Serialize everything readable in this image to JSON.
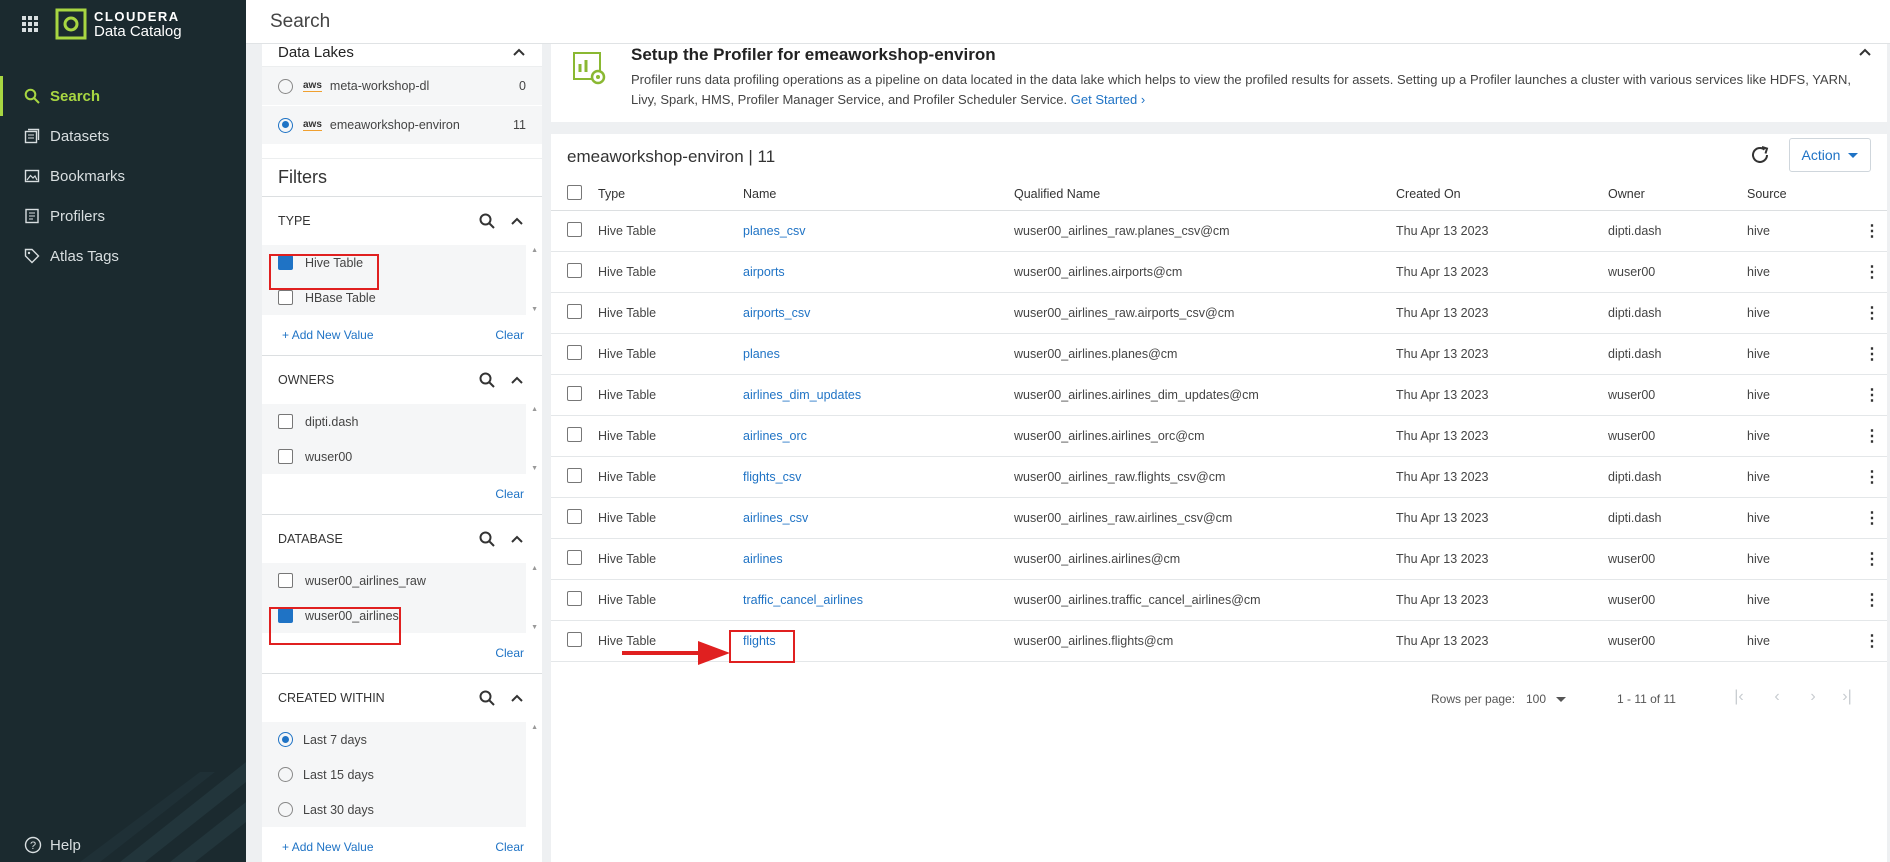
{
  "app": {
    "brand_name": "CLOUDERA",
    "product_name": "Data Catalog",
    "page_title": "Search"
  },
  "nav": {
    "items": [
      {
        "label": "Search",
        "icon": "search-icon",
        "active": true
      },
      {
        "label": "Datasets",
        "icon": "datasets-icon",
        "active": false
      },
      {
        "label": "Bookmarks",
        "icon": "bookmarks-icon",
        "active": false
      },
      {
        "label": "Profilers",
        "icon": "profilers-icon",
        "active": false
      },
      {
        "label": "Atlas Tags",
        "icon": "tag-icon",
        "active": false
      }
    ],
    "help_label": "Help"
  },
  "data_lakes": {
    "title": "Data Lakes",
    "items": [
      {
        "provider": "aws",
        "name": "meta-workshop-dl",
        "count": "0",
        "selected": false
      },
      {
        "provider": "aws",
        "name": "emeaworkshop-environ",
        "count": "11",
        "selected": true
      }
    ]
  },
  "filters": {
    "title": "Filters",
    "type": {
      "label": "TYPE",
      "options": [
        {
          "label": "Hive Table",
          "checked": true
        },
        {
          "label": "HBase Table",
          "checked": false
        }
      ],
      "add_label": "Add New Value",
      "clear_label": "Clear"
    },
    "owners": {
      "label": "OWNERS",
      "options": [
        {
          "label": "dipti.dash",
          "checked": false
        },
        {
          "label": "wuser00",
          "checked": false
        }
      ],
      "clear_label": "Clear"
    },
    "database": {
      "label": "DATABASE",
      "options": [
        {
          "label": "wuser00_airlines_raw",
          "checked": false
        },
        {
          "label": "wuser00_airlines",
          "checked": true
        }
      ],
      "clear_label": "Clear"
    },
    "created_within": {
      "label": "CREATED WITHIN",
      "options": [
        {
          "label": "Last 7 days",
          "selected": true
        },
        {
          "label": "Last 15 days",
          "selected": false
        },
        {
          "label": "Last 30 days",
          "selected": false
        }
      ],
      "add_label": "Add New Value",
      "clear_label": "Clear"
    }
  },
  "banner": {
    "title": "Setup the Profiler for emeaworkshop-environ",
    "description": "Profiler runs data profiling operations as a pipeline on data located in the data lake which helps to view the profiled results for assets. Setting up a Profiler launches a cluster with various services like HDFS, YARN, Livy, Spark, HMS, Profiler Manager Service, and Profiler Scheduler Service.",
    "link_label": "Get Started"
  },
  "results": {
    "title": "emeaworkshop-environ | 11",
    "action_label": "Action",
    "columns": [
      "Type",
      "Name",
      "Qualified Name",
      "Created On",
      "Owner",
      "Source"
    ],
    "rows": [
      {
        "type": "Hive Table",
        "name": "planes_csv",
        "qualified_name": "wuser00_airlines_raw.planes_csv@cm",
        "created_on": "Thu Apr 13 2023",
        "owner": "dipti.dash",
        "source": "hive"
      },
      {
        "type": "Hive Table",
        "name": "airports",
        "qualified_name": "wuser00_airlines.airports@cm",
        "created_on": "Thu Apr 13 2023",
        "owner": "wuser00",
        "source": "hive"
      },
      {
        "type": "Hive Table",
        "name": "airports_csv",
        "qualified_name": "wuser00_airlines_raw.airports_csv@cm",
        "created_on": "Thu Apr 13 2023",
        "owner": "dipti.dash",
        "source": "hive"
      },
      {
        "type": "Hive Table",
        "name": "planes",
        "qualified_name": "wuser00_airlines.planes@cm",
        "created_on": "Thu Apr 13 2023",
        "owner": "dipti.dash",
        "source": "hive"
      },
      {
        "type": "Hive Table",
        "name": "airlines_dim_updates",
        "qualified_name": "wuser00_airlines.airlines_dim_updates@cm",
        "created_on": "Thu Apr 13 2023",
        "owner": "wuser00",
        "source": "hive"
      },
      {
        "type": "Hive Table",
        "name": "airlines_orc",
        "qualified_name": "wuser00_airlines.airlines_orc@cm",
        "created_on": "Thu Apr 13 2023",
        "owner": "wuser00",
        "source": "hive"
      },
      {
        "type": "Hive Table",
        "name": "flights_csv",
        "qualified_name": "wuser00_airlines_raw.flights_csv@cm",
        "created_on": "Thu Apr 13 2023",
        "owner": "dipti.dash",
        "source": "hive"
      },
      {
        "type": "Hive Table",
        "name": "airlines_csv",
        "qualified_name": "wuser00_airlines_raw.airlines_csv@cm",
        "created_on": "Thu Apr 13 2023",
        "owner": "dipti.dash",
        "source": "hive"
      },
      {
        "type": "Hive Table",
        "name": "airlines",
        "qualified_name": "wuser00_airlines.airlines@cm",
        "created_on": "Thu Apr 13 2023",
        "owner": "wuser00",
        "source": "hive"
      },
      {
        "type": "Hive Table",
        "name": "traffic_cancel_airlines",
        "qualified_name": "wuser00_airlines.traffic_cancel_airlines@cm",
        "created_on": "Thu Apr 13 2023",
        "owner": "wuser00",
        "source": "hive"
      },
      {
        "type": "Hive Table",
        "name": "flights",
        "qualified_name": "wuser00_airlines.flights@cm",
        "created_on": "Thu Apr 13 2023",
        "owner": "wuser00",
        "source": "hive"
      }
    ],
    "pagination": {
      "rows_per_page_label": "Rows per page:",
      "rows_per_page_value": "100",
      "range": "1 - 11 of 11"
    }
  },
  "colors": {
    "nav_bg": "#1b2a2f",
    "accent_green": "#a8d642",
    "link_blue": "#1f73c5",
    "highlight_red": "#e02020"
  }
}
